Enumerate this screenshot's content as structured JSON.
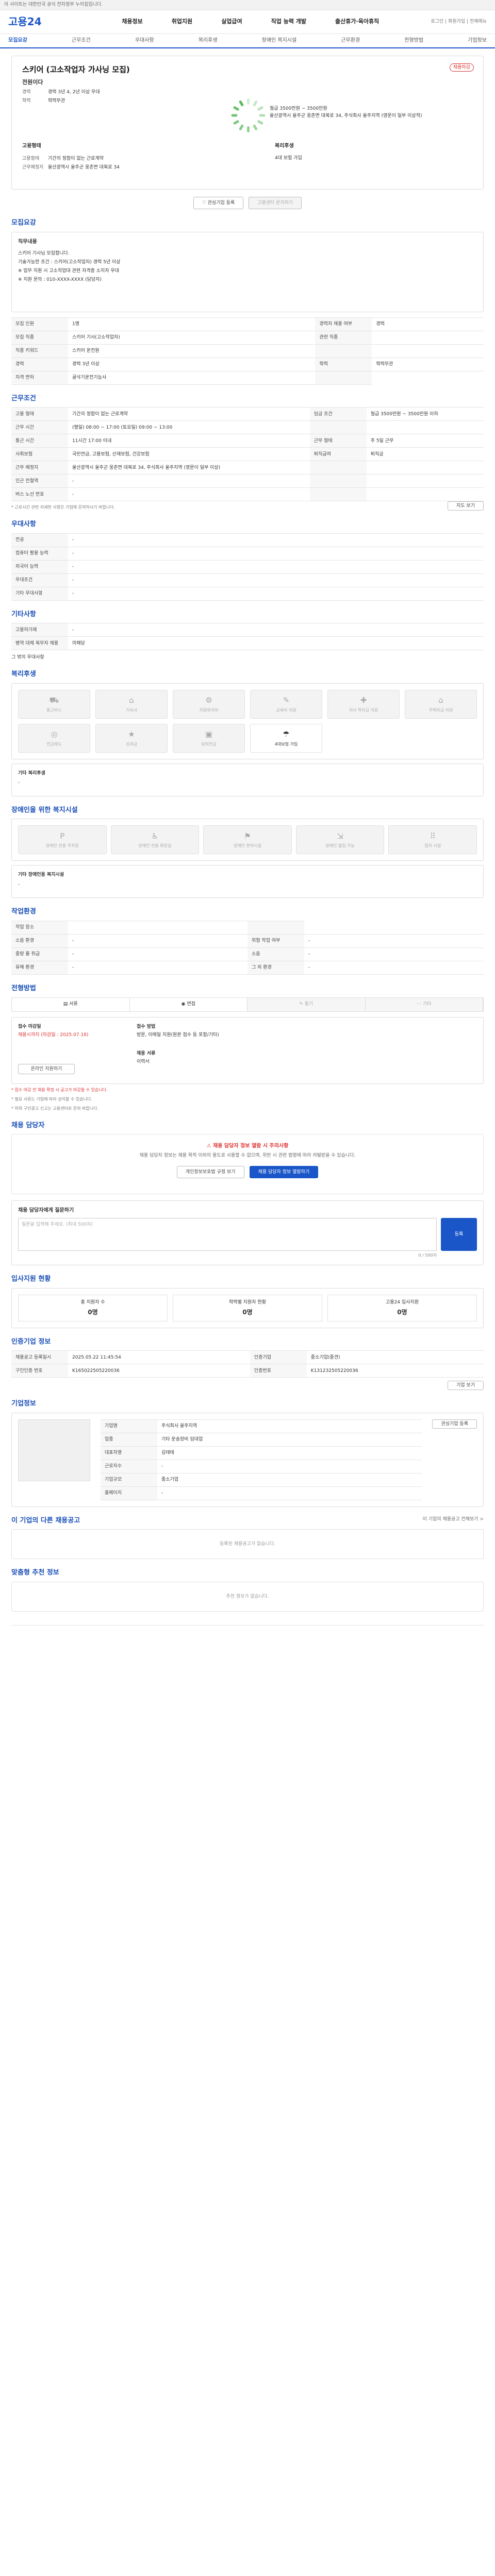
{
  "topbar": {
    "text": "이 사이트는 대한민국 공식 전자정부 누리집입니다."
  },
  "header": {
    "logo": "고용24",
    "right_util": "로그인 | 회원가입 | 전체메뉴",
    "gnb": [
      "채용정보",
      "취업지원",
      "실업급여",
      "직업 능력 개발",
      "출산휴가·육아휴직"
    ]
  },
  "tabs": [
    "모집요강",
    "근무조건",
    "우대사항",
    "복리후생",
    "장애인 복지시설",
    "근무환경",
    "전형방법",
    "기업정보"
  ],
  "job": {
    "title": "스키어 (고소작업자 가사닝 모집)",
    "status": "채용마감",
    "company": "전원이다",
    "kv": [
      {
        "k": "경력",
        "v": "경력 3년 4, 2년 이상 우대"
      },
      {
        "k": "학력",
        "v": "학력무관"
      }
    ],
    "wage_title": "고용형태",
    "right_title": "임금조건",
    "wage": [
      {
        "k": "고용형태",
        "v": "기간의 정함이 없는 근로계약"
      },
      {
        "k": "근무예정지",
        "v": "울산광역시 울주군 웅촌면 대복로 34"
      }
    ],
    "pay": "월급 3500만원 ~ 3500만원",
    "addr": "울산광역시 울주군 웅촌면 대복로 34, 주식회사 울주지역 (영문이 일부 이상적)",
    "welfare_title": "복리후생",
    "welfare": "4대 보험 가입"
  },
  "actions": {
    "apply": "입사지원",
    "fav": "관심기업 등록",
    "ask": "고용센터 문의하기"
  },
  "recruit": {
    "title": "모집요강",
    "box_title": "직무내용",
    "box_lines": [
      "스키어 기사님 모집합니다.",
      "기술가능한 조건 : 스키어(고소작업자) 경력 5년 이상",
      "※ 업무 지원 시 고소작업대 관련 자격증 소지자 우대",
      "※ 지원 문의 : 010-XXXX-XXXX (담당자)"
    ],
    "rows": [
      [
        "모집 인원",
        "1명",
        "경력자 채용 여부",
        "경력"
      ],
      [
        "모집 직종",
        "스키어 기사(고소작업자)",
        "관련 직종",
        ""
      ],
      [
        "직종 키워드",
        "스키어 운전원",
        ""
      ],
      [
        "경력",
        "경력 3년 이상",
        "학력",
        "학력무관"
      ],
      [
        "자격 면허",
        "굴삭기운전기능사",
        ""
      ]
    ]
  },
  "work": {
    "title": "근무조건",
    "rows": [
      [
        "고용 형태",
        "기간의 정함이 없는 근로계약",
        "임금 조건",
        "월급 3500만원 ~ 3500만원 이하"
      ],
      [
        "근무 시간",
        "(평일) 08:00 ~ 17:00 (토요일) 09:00 ~ 13:00",
        ""
      ],
      [
        "통근 시간",
        "11시간 17:00 이내",
        "근무 형태",
        "주 5일 근무"
      ],
      [
        "사회보험",
        "국민연금, 고용보험, 산재보험, 건강보험",
        "퇴직급여",
        "퇴직금"
      ],
      [
        "근무 예정지",
        "울산광역시 울주군 웅촌면 대복로 34, 주식회사 울주지역 (영문이 일부 이상)",
        "",
        ""
      ],
      [
        "인근 전철역",
        "-",
        "",
        ""
      ],
      [
        "버스 노선 번호",
        "-",
        "",
        ""
      ]
    ],
    "note": "* 근로시간 관련 자세한 사항은 기업에 문의하시기 바랍니다.",
    "map_btn": "지도 보기"
  },
  "prefer": {
    "title": "우대사항",
    "rows": [
      [
        "전공",
        "-"
      ],
      [
        "컴퓨터 활용 능력",
        "-"
      ],
      [
        "외국어 능력",
        "-"
      ],
      [
        "우대조건",
        "-"
      ],
      [
        "기타 우대사항",
        "-"
      ]
    ]
  },
  "other": {
    "title": "기타사항",
    "rows": [
      [
        "고용허가제",
        "-"
      ],
      [
        "병역 대체 복무자 채용",
        "미해당"
      ]
    ],
    "extra": "그 밖의 우대사항"
  },
  "benefits": {
    "title": "복리후생",
    "tiles": [
      {
        "l": "통근버스",
        "o": false
      },
      {
        "l": "기숙사",
        "o": false
      },
      {
        "l": "차량유지비",
        "o": false
      },
      {
        "l": "교육비 지원",
        "o": false
      },
      {
        "l": "자녀 학자금 지원",
        "o": false
      },
      {
        "l": "주택자금 지원",
        "o": false
      },
      {
        "l": "연금제도",
        "o": false
      },
      {
        "l": "성과급",
        "o": false
      },
      {
        "l": "퇴직연금",
        "o": false
      },
      {
        "l": "4대보험 가입",
        "o": true
      }
    ],
    "extra_title": "기타 복리후생",
    "extra": "-"
  },
  "disab": {
    "title": "장애인을 위한 복지시설",
    "tiles": [
      {
        "l": "장애인 전용 주차장",
        "o": false
      },
      {
        "l": "장애인 전용 화장실",
        "o": false
      },
      {
        "l": "장애인 편의시설",
        "o": false
      },
      {
        "l": "장애인 출입 가능",
        "o": false
      },
      {
        "l": "점자 시설",
        "o": false
      }
    ],
    "extra_title": "기타 장애인용 복지시설",
    "extra": "-"
  },
  "env": {
    "title": "작업환경",
    "rows": [
      [
        "작업 장소",
        "",
        ""
      ],
      [
        "소음 환경",
        "-",
        "위험 작업 여부",
        "-"
      ],
      [
        "중량 물 취급",
        "-",
        "소음",
        "-"
      ],
      [
        "유해 환경",
        "-",
        "그 외 환경",
        "-"
      ]
    ]
  },
  "proc": {
    "title": "전형방법",
    "steps": [
      "서류",
      "면접",
      "필기",
      "기타"
    ],
    "info": [
      {
        "k": "접수 마감일",
        "v": "채용시까지 (마감일 : 2025.07.18)"
      },
      {
        "k": "접수 방법",
        "v": "방문, 이메일 지원(원본 접수 등 포함/기타)"
      },
      {
        "k": "채용 서류",
        "v": "이력서"
      }
    ],
    "apply_btn": "온라인 지원하기",
    "notes": [
      "* 접수 마감 전 채용 확정 시 공고가 마감될 수 있습니다.",
      "* 필요 서류는 기업에 따라 상이할 수 있습니다.",
      "* 허위 구인광고 신고는 고용센터로 문의 바랍니다."
    ]
  },
  "manager": {
    "title": "채용 담당자",
    "alert": "채용 담당자 정보 열람 시 주의사항",
    "desc": "채용 담당자 정보는 채용 목적 이외의 용도로 사용할 수 없으며, 위반 시 관련 법령에 따라 처벌받을 수 있습니다.",
    "btn1": "개인정보보호법 규정 보기",
    "btn2": "채용 담당자 정보 열람하기",
    "inq_title": "채용 담당자에게 질문하기",
    "inq_hint": "질문을 입력해 주세요. (최대 500자)",
    "inq_btn": "등록",
    "inq_count": "0 / 500자"
  },
  "stats": {
    "title": "입사지원 현황",
    "cards": [
      {
        "l": "총 지원자 수",
        "v": "0명"
      },
      {
        "l": "학력별 지원자 현황",
        "v": "0명"
      },
      {
        "l": "고용24 입사지원",
        "v": "0명"
      }
    ]
  },
  "jobinfo": {
    "title": "인증기업 정보",
    "rows": [
      [
        "채용공고 등록일시",
        "2025.05.22 11:45:54",
        "인증기업",
        "중소기업(중견)"
      ],
      [
        "구인인증 번호",
        "K165022505220036",
        "인증번호",
        "K131232505220036"
      ]
    ],
    "btn": "기업 보기"
  },
  "company": {
    "title": "기업정보",
    "rows": [
      [
        "기업명",
        "주식회사 울주지역"
      ],
      [
        "업종",
        "기타 운송장비 임대업"
      ],
      [
        "대표자명",
        "김태태"
      ],
      [
        "근로자수",
        "-"
      ],
      [
        "기업규모",
        "중소기업"
      ],
      [
        "홈페이지",
        "-"
      ]
    ],
    "btn": "관심기업 등록"
  },
  "more": {
    "title": "이 기업의 다른 채용공고",
    "link": "이 기업의 채용공고 전체보기 >",
    "empty": "등록된 채용공고가 없습니다."
  },
  "rec": {
    "title": "맞춤형 추천 정보",
    "empty": "추천 정보가 없습니다."
  }
}
